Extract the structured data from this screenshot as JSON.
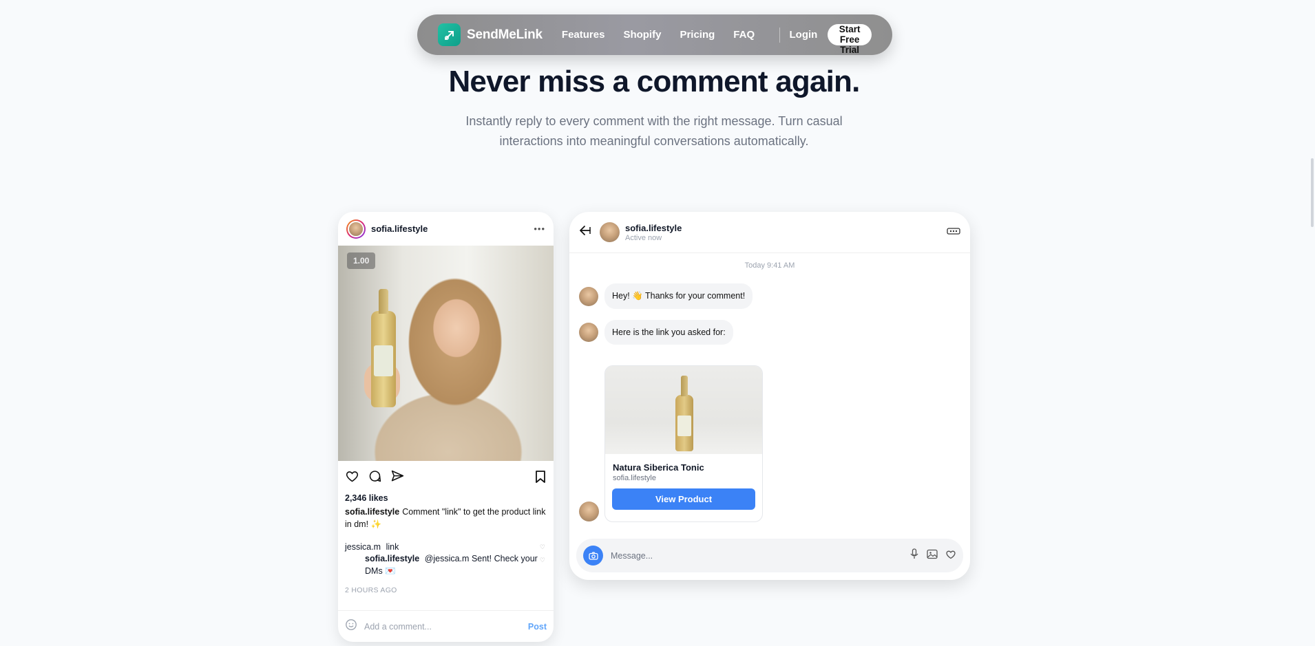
{
  "nav": {
    "brand": "SendMeLink",
    "links": [
      "Features",
      "Shopify",
      "Pricing",
      "FAQ"
    ],
    "login": "Login",
    "cta": "Start Free Trial"
  },
  "hero": {
    "title": "Never miss a comment again.",
    "subtitle": "Instantly reply to every comment with the right message. Turn casual interactions into meaningful conversations automatically."
  },
  "post": {
    "username": "sofia.lifestyle",
    "speed": "1.00",
    "likes": "2,346 likes",
    "caption_user": "sofia.lifestyle",
    "caption_text": "Comment \"link\" to get the product link in dm! ✨",
    "comment_user": "jessica.m",
    "comment_text": "link",
    "reply_user": "sofia.lifestyle",
    "reply_text": "@jessica.m Sent! Check your DMs 💌",
    "time": "2 HOURS AGO",
    "add_comment_placeholder": "Add a comment...",
    "post_label": "Post"
  },
  "dm": {
    "username": "sofia.lifestyle",
    "status": "Active now",
    "date": "Today 9:41 AM",
    "messages": [
      "Hey! 👋 Thanks for your comment!",
      "Here is the link you asked for:"
    ],
    "product": {
      "title": "Natura Siberica Tonic",
      "seller": "sofia.lifestyle",
      "button": "View Product"
    },
    "composer_placeholder": "Message..."
  },
  "colors": {
    "accent": "#3b82f6",
    "brand": "#14b8a6"
  }
}
